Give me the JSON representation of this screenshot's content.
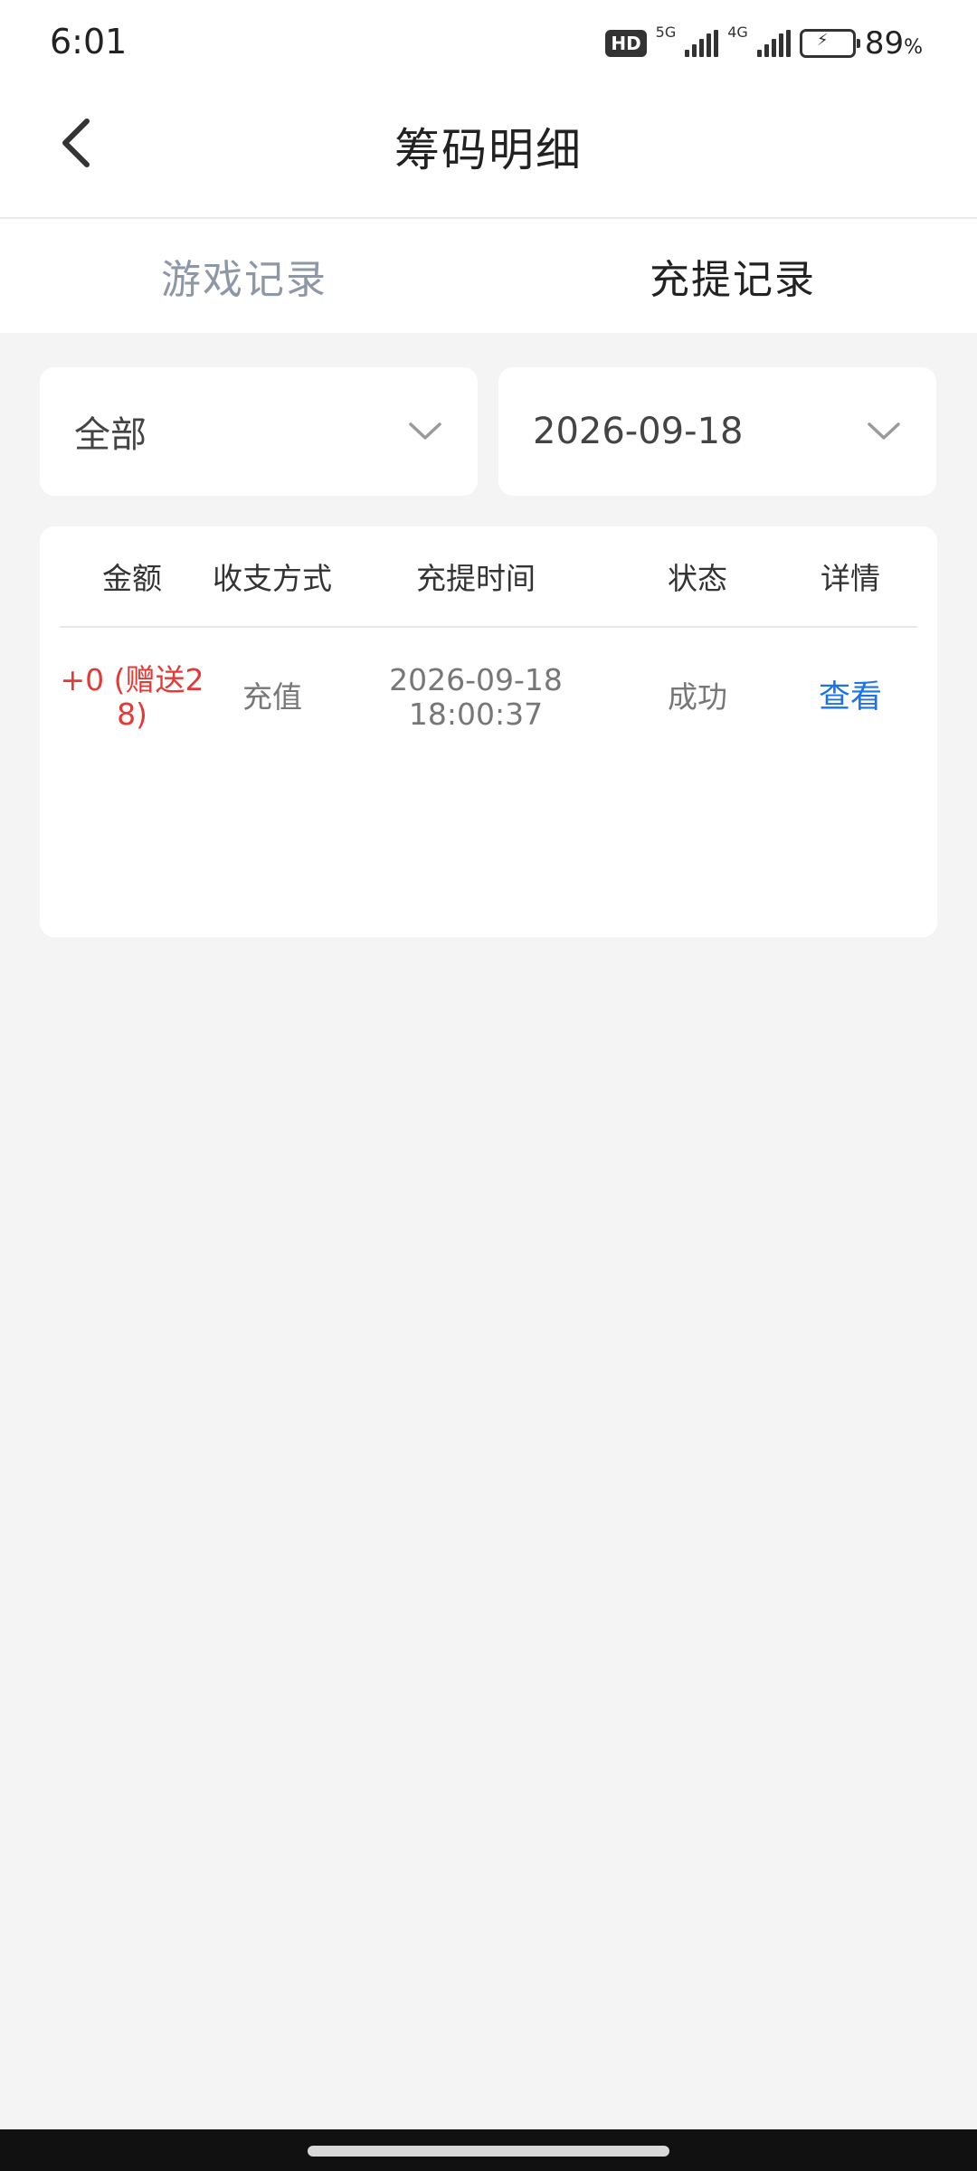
{
  "status_bar": {
    "time": "6:01",
    "hd_badge": "HD",
    "network_1": "5G",
    "network_2": "4G",
    "battery_percent": "89",
    "battery_unit": "%",
    "battery_level": 0.89
  },
  "header": {
    "title": "筹码明细",
    "back_icon": "chevron-left-icon"
  },
  "tabs": [
    {
      "label": "游戏记录",
      "active": false
    },
    {
      "label": "充提记录",
      "active": true
    }
  ],
  "filters": {
    "type_value": "全部",
    "date_value": "2026-09-18",
    "dropdown_icon": "chevron-down-icon"
  },
  "table": {
    "columns": [
      "金额",
      "收支方式",
      "充提时间",
      "状态",
      "详情"
    ],
    "rows": [
      {
        "amount_line1": "+0 (赠送2",
        "amount_line2": "8)",
        "method": "充值",
        "date": "2026-09-18",
        "time": "18:00:37",
        "status": "成功",
        "detail": "查看"
      }
    ]
  },
  "colors": {
    "accent_link": "#1a73e8",
    "amount_red": "#e53935",
    "background": "#f4f4f4",
    "battery_green": "#5dc94a"
  }
}
